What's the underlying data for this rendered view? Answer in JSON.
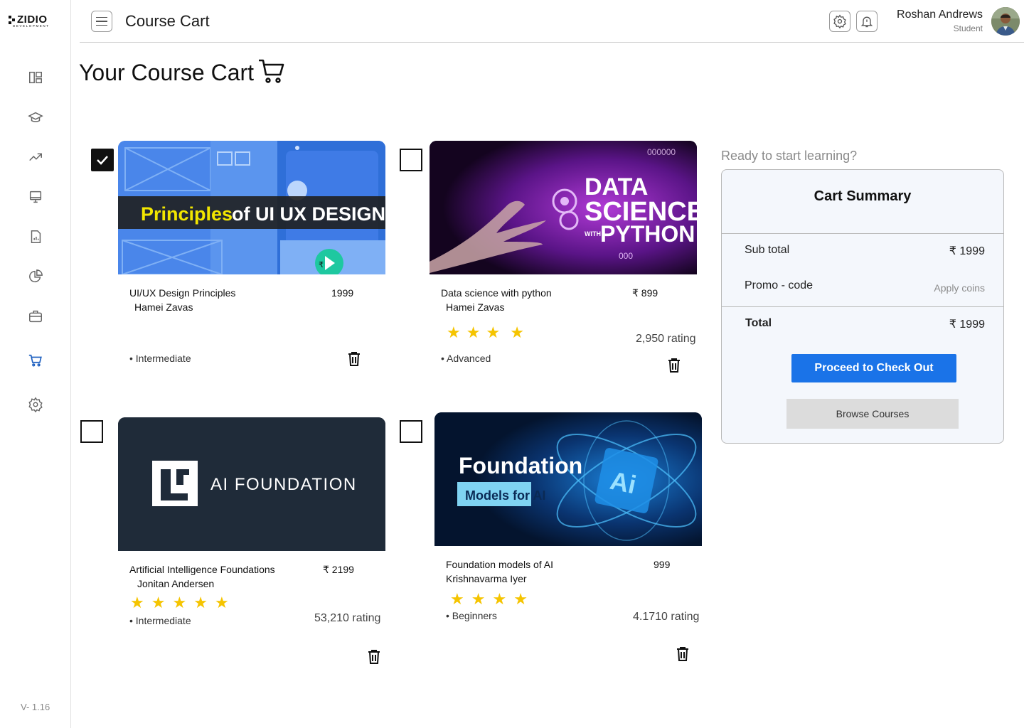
{
  "brand": {
    "name": "ZIDIO",
    "tagline": "DEVELOPMENT"
  },
  "version": "V- 1.16",
  "header": {
    "title": "Course Cart",
    "user": {
      "name": "Roshan Andrews",
      "role": "Student"
    }
  },
  "sidebar": {
    "items": [
      {
        "icon": "dashboard-icon",
        "active": false
      },
      {
        "icon": "graduation-cap-icon",
        "active": false
      },
      {
        "icon": "trending-icon",
        "active": false
      },
      {
        "icon": "monitor-icon",
        "active": false
      },
      {
        "icon": "report-icon",
        "active": false
      },
      {
        "icon": "pie-chart-icon",
        "active": false
      },
      {
        "icon": "briefcase-icon",
        "active": false
      },
      {
        "icon": "cart-icon",
        "active": true
      },
      {
        "icon": "settings-icon",
        "active": false
      }
    ]
  },
  "main": {
    "title": "Your Course Cart"
  },
  "courses": [
    {
      "thumb_text": "Principles of UI UX DESIGN",
      "thumb_accent": "Principles",
      "title": "UI/UX Design Principles",
      "author": "Hamei Zavas",
      "price": "1999",
      "level": "• Intermediate",
      "rating_text": "",
      "stars": 0,
      "checked": true
    },
    {
      "thumb_text": "DATA SCIENCE WITH PYTHON",
      "title": "Data science with python",
      "author": "Hamei Zavas",
      "price": "₹ 899",
      "level": "• Advanced",
      "rating_text": "2,950 rating",
      "stars": 4,
      "checked": false
    },
    {
      "thumb_text": "AI FOUNDATION",
      "title": "Artificial Intelligence Foundations",
      "author": "Jonitan Andersen",
      "price": "₹ 2199",
      "level": "• Intermediate",
      "rating_text": "53,210 rating",
      "stars": 5,
      "checked": false
    },
    {
      "thumb_text": "Foundation",
      "thumb_sub": "Models for AI",
      "title": "Foundation models of AI",
      "author": "Krishnavarma Iyer",
      "price": "999",
      "level": "• Beginners",
      "rating_text": "4.1710 rating",
      "stars": 4,
      "checked": false
    }
  ],
  "summary": {
    "prompt": "Ready to start learning?",
    "title": "Cart Summary",
    "subtotal_label": "Sub total",
    "subtotal_value": "₹ 1999",
    "promo_label": "Promo - code",
    "promo_action": "Apply coins",
    "total_label": "Total",
    "total_value": "₹  1999",
    "checkout_label": "Proceed to Check Out",
    "browse_label": "Browse Courses"
  },
  "colors": {
    "primary": "#1a73e8",
    "star": "#f5c400",
    "summary_bg": "#f4f7fc"
  }
}
